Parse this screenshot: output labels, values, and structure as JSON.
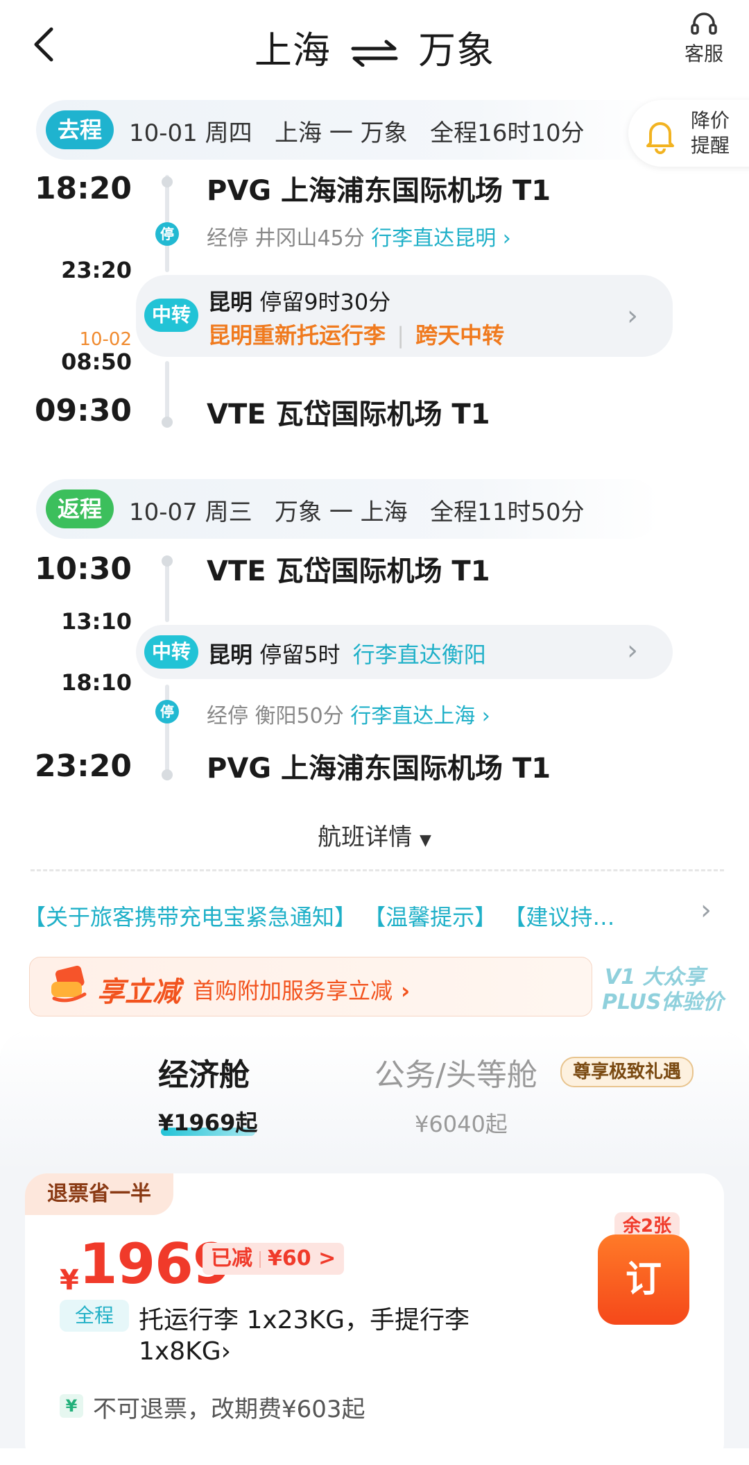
{
  "header": {
    "from_city": "上海",
    "to_city": "万象",
    "service_label": "客服"
  },
  "price_alert": {
    "line1": "降价",
    "line2": "提醒"
  },
  "outbound": {
    "tag": "去程",
    "summary": "10-01 周四   上海 一 万象   全程16时10分",
    "depart_time": "18:20",
    "depart_airport": "PVG 上海浦东国际机场 T1",
    "stop_badge": "停",
    "stop_text": "经停 井冈山45分",
    "stop_link": "行李直达昆明",
    "arrive_transfer_time": "23:20",
    "transfer_date": "10-02",
    "depart_transfer_time": "08:50",
    "transfer_tag": "中转",
    "transfer_city": "昆明",
    "transfer_stay": "停留9时30分",
    "transfer_note1": "昆明重新托运行李",
    "transfer_note2": "跨天中转",
    "arrive_time": "09:30",
    "arrive_airport": "VTE 瓦岱国际机场 T1"
  },
  "return": {
    "tag": "返程",
    "summary": "10-07 周三   万象 一 上海   全程11时50分",
    "depart_time": "10:30",
    "depart_airport": "VTE 瓦岱国际机场 T1",
    "arrive_transfer_time": "13:10",
    "transfer_tag": "中转",
    "transfer_city": "昆明",
    "transfer_stay": "停留5时",
    "transfer_link": "行李直达衡阳",
    "depart_transfer_time": "18:10",
    "stop_badge": "停",
    "stop_text": "经停 衡阳50分",
    "stop_link": "行李直达上海",
    "arrive_time": "23:20",
    "arrive_airport": "PVG 上海浦东国际机场 T1"
  },
  "flight_details_label": "航班详情",
  "notice_text": "【关于旅客携带充电宝紧急通知】 【温馨提示】 【建议持…",
  "promo": {
    "title": "享立减",
    "subtitle": "首购附加服务享立减",
    "plus_line1": "V1 大众享",
    "plus_line2": "PLUS体验价"
  },
  "cabins": {
    "economy_label": "经济舱",
    "economy_price": "¥1969起",
    "business_label": "公务/头等舱",
    "business_badge": "尊享极致礼遇",
    "business_price": "¥6040起"
  },
  "fare": {
    "refund_tag": "退票省一半",
    "currency": "¥",
    "price": "1969",
    "discount_label": "已减",
    "discount_value": "¥60 >",
    "remaining": "余2张",
    "book_label": "订",
    "scope_tag": "全程",
    "baggage_line1": "托运行李 1x23KG，手提行李",
    "baggage_line2": "1x8KG",
    "refund_icon": "¥",
    "refund_text": "不可退票，改期费¥603起"
  }
}
